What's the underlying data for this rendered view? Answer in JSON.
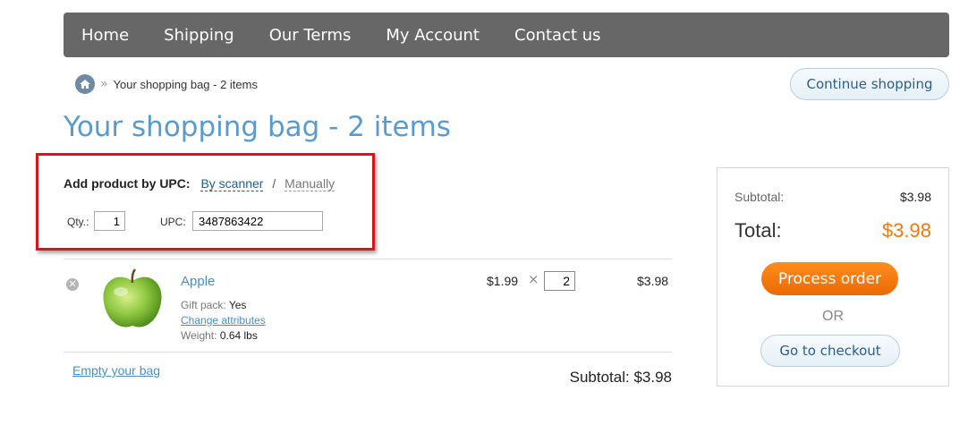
{
  "nav": [
    "Home",
    "Shipping",
    "Our Terms",
    "My Account",
    "Contact us"
  ],
  "breadcrumb": {
    "sep": "»",
    "current": "Your shopping bag - 2 items"
  },
  "continue_label": "Continue shopping",
  "page_title": "Your shopping bag - 2 items",
  "upc": {
    "label": "Add product by UPC:",
    "by_scanner": "By scanner",
    "slash": "/",
    "manually": "Manually",
    "qty_label": "Qty.:",
    "qty_value": "1",
    "upc_label": "UPC:",
    "upc_value": "3487863422"
  },
  "item": {
    "name": "Apple",
    "gift_label": "Gift pack:",
    "gift_value": "Yes",
    "change_attributes": "Change attributes",
    "weight_label": "Weight:",
    "weight_value": "0.64 lbs",
    "price": "$1.99",
    "times": "×",
    "qty": "2",
    "total": "$3.98"
  },
  "empty_bag": "Empty your bag",
  "bag_subtotal": "Subtotal: $3.98",
  "summary": {
    "subtotal_label": "Subtotal:",
    "subtotal_value": "$3.98",
    "total_label": "Total:",
    "total_value": "$3.98",
    "process_label": "Process order",
    "or_label": "OR",
    "checkout_label": "Go to checkout"
  },
  "colors": {
    "nav_bg": "#676767",
    "title": "#5a9bcf",
    "accent_orange": "#f0780e",
    "highlight_border": "#d6161b",
    "link": "#4a90c8"
  }
}
